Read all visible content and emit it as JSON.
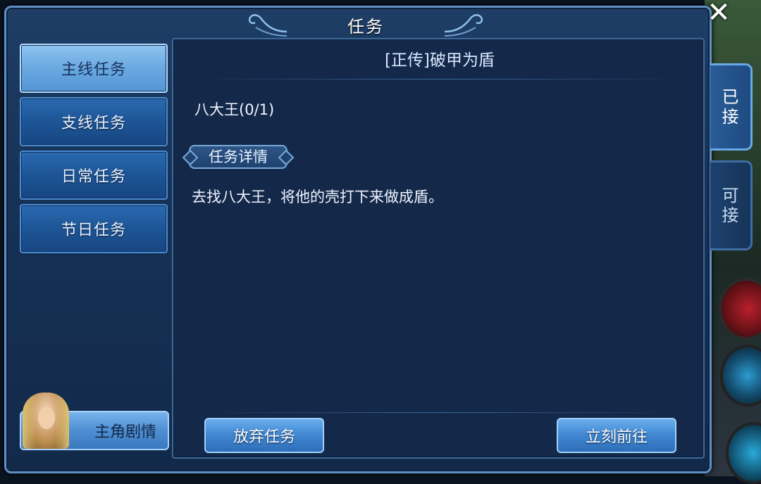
{
  "window": {
    "title": "任务",
    "close_symbol": "✕"
  },
  "categories": [
    {
      "label": "主线任务",
      "active": true
    },
    {
      "label": "支线任务",
      "active": false
    },
    {
      "label": "日常任务",
      "active": false
    },
    {
      "label": "节日任务",
      "active": false
    }
  ],
  "hero_button": {
    "label": "主角剧情"
  },
  "quest": {
    "title": "[正传]破甲为盾",
    "objective": "八大王(0/1)",
    "detail_label": "任务详情",
    "description": "去找八大王，将他的壳打下来做成盾。"
  },
  "actions": {
    "abandon_label": "放弃任务",
    "goto_label": "立刻前往"
  },
  "side_tabs": [
    {
      "label_line1": "已",
      "label_line2": "接",
      "active": true
    },
    {
      "label_line1": "可",
      "label_line2": "接",
      "active": false
    }
  ]
}
